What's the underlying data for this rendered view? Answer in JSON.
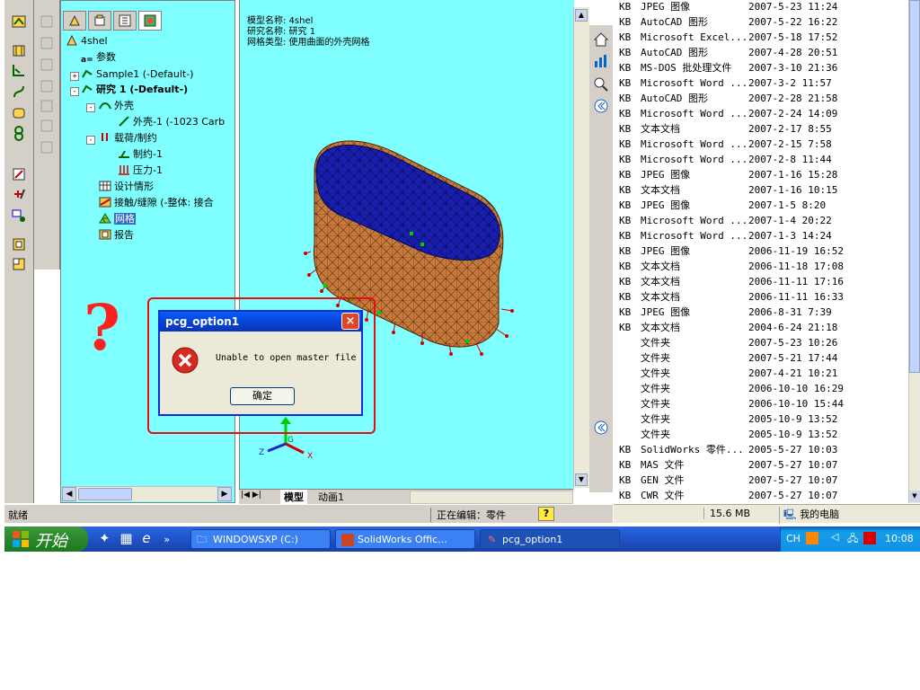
{
  "feature_manager": {
    "root": "4shel",
    "items": [
      {
        "label": "参数"
      },
      {
        "label": "Sample1 (-Default-)"
      },
      {
        "label": "研究 1 (-Default-)"
      },
      {
        "label": "外壳"
      },
      {
        "label": "外壳-1 (-1023 Carb"
      },
      {
        "label": "载荷/制约"
      },
      {
        "label": "制约-1"
      },
      {
        "label": "压力-1"
      },
      {
        "label": "设计情形"
      },
      {
        "label": "接触/缝隙 (-整体: 接合"
      },
      {
        "label": "网格"
      },
      {
        "label": "报告"
      }
    ]
  },
  "graphics": {
    "info_model": "模型名称: 4shel",
    "info_study": "研究名称: 研究 1",
    "info_mesh": "网格类型: 使用曲面的外壳网格",
    "tab_model": "模型",
    "tab_anim": "动画1"
  },
  "statusbar": {
    "left": "就绪",
    "editing": "正在编辑：零件",
    "help": "?"
  },
  "annotation": {
    "mark": "?"
  },
  "dialog": {
    "title": "pcg_option1",
    "message": "Unable to open master file",
    "ok": "确定",
    "close": "×"
  },
  "explorer": {
    "rows": [
      {
        "size": "KB",
        "type": "JPEG 图像",
        "date": "2007-5-23 11:24"
      },
      {
        "size": "KB",
        "type": "AutoCAD 图形",
        "date": "2007-5-22 16:22"
      },
      {
        "size": "KB",
        "type": "Microsoft Excel...",
        "date": "2007-5-18 17:52"
      },
      {
        "size": "KB",
        "type": "AutoCAD 图形",
        "date": "2007-4-28 20:51"
      },
      {
        "size": "KB",
        "type": "MS-DOS 批处理文件",
        "date": "2007-3-10 21:36"
      },
      {
        "size": "KB",
        "type": "Microsoft Word ...",
        "date": "2007-3-2 11:57"
      },
      {
        "size": "KB",
        "type": "AutoCAD 图形",
        "date": "2007-2-28 21:58"
      },
      {
        "size": "KB",
        "type": "Microsoft Word ...",
        "date": "2007-2-24 14:09"
      },
      {
        "size": "KB",
        "type": "文本文档",
        "date": "2007-2-17 8:55"
      },
      {
        "size": "KB",
        "type": "Microsoft Word ...",
        "date": "2007-2-15 7:58"
      },
      {
        "size": "KB",
        "type": "Microsoft Word ...",
        "date": "2007-2-8 11:44"
      },
      {
        "size": "KB",
        "type": "JPEG 图像",
        "date": "2007-1-16 15:28"
      },
      {
        "size": "KB",
        "type": "文本文档",
        "date": "2007-1-16 10:15"
      },
      {
        "size": "KB",
        "type": "JPEG 图像",
        "date": "2007-1-5 8:20"
      },
      {
        "size": "KB",
        "type": "Microsoft Word ...",
        "date": "2007-1-4 20:22"
      },
      {
        "size": "KB",
        "type": "Microsoft Word ...",
        "date": "2007-1-3 14:24"
      },
      {
        "size": "KB",
        "type": "JPEG 图像",
        "date": "2006-11-19 16:52"
      },
      {
        "size": "KB",
        "type": "文本文档",
        "date": "2006-11-18 17:08"
      },
      {
        "size": "KB",
        "type": "文本文档",
        "date": "2006-11-11 17:16"
      },
      {
        "size": "KB",
        "type": "文本文档",
        "date": "2006-11-11 16:33"
      },
      {
        "size": "KB",
        "type": "JPEG 图像",
        "date": "2006-8-31 7:39"
      },
      {
        "size": "KB",
        "type": "文本文档",
        "date": "2004-6-24 21:18"
      },
      {
        "size": "",
        "type": "文件夹",
        "date": "2007-5-23 10:26"
      },
      {
        "size": "",
        "type": "文件夹",
        "date": "2007-5-21 17:44"
      },
      {
        "size": "",
        "type": "文件夹",
        "date": "2007-4-21 10:21"
      },
      {
        "size": "",
        "type": "文件夹",
        "date": "2006-10-10 16:29"
      },
      {
        "size": "",
        "type": "文件夹",
        "date": "2006-10-10 15:44"
      },
      {
        "size": "",
        "type": "文件夹",
        "date": "2005-10-9 13:52"
      },
      {
        "size": "",
        "type": "文件夹",
        "date": "2005-10-9 13:52"
      },
      {
        "size": "KB",
        "type": "SolidWorks 零件...",
        "date": "2005-5-27 10:03"
      },
      {
        "size": "KB",
        "type": "MAS 文件",
        "date": "2007-5-27 10:07"
      },
      {
        "size": "KB",
        "type": "GEN 文件",
        "date": "2007-5-27 10:07"
      },
      {
        "size": "KB",
        "type": "CWR 文件",
        "date": "2007-5-27 10:07"
      }
    ],
    "status_size": "15.6 MB",
    "status_location": "我的电脑"
  },
  "taskbar": {
    "start": "开始",
    "tasks": [
      {
        "label": "WINDOWSXP (C:)"
      },
      {
        "label": "SolidWorks Offic..."
      },
      {
        "label": "pcg_option1"
      }
    ],
    "tray_lang": "CH",
    "clock": "10:08"
  }
}
